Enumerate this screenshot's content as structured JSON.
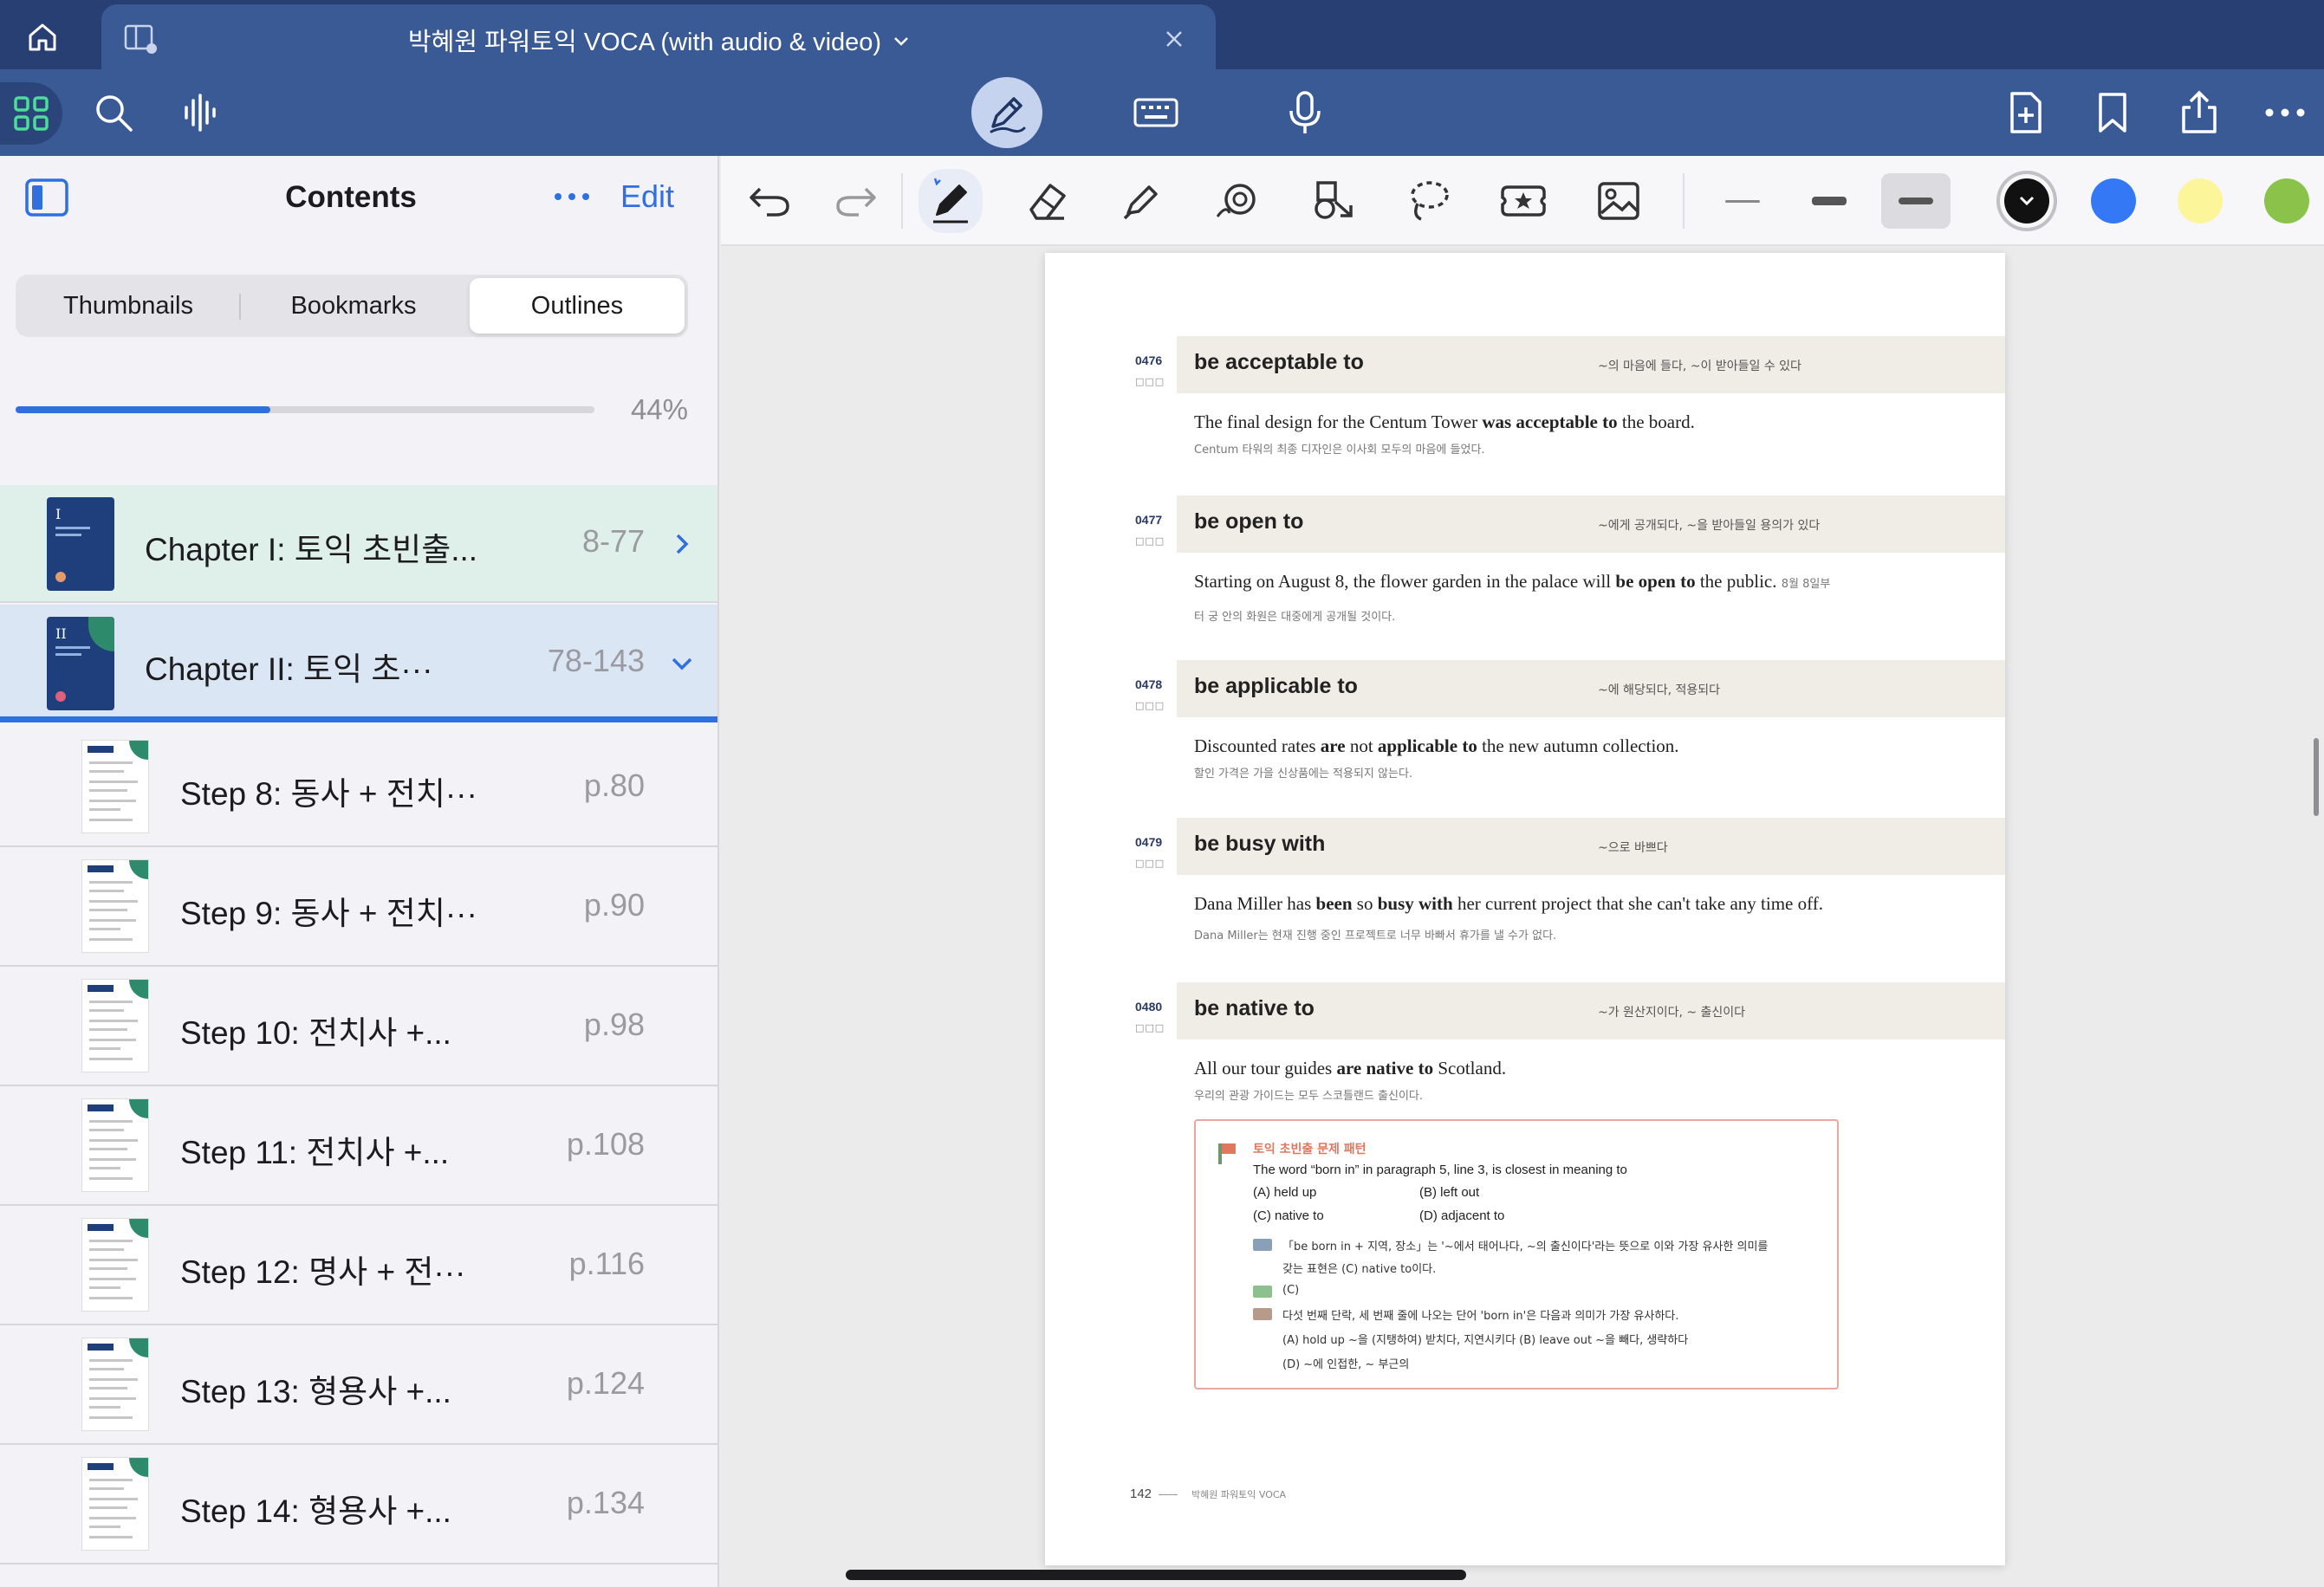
{
  "tab": {
    "title": "박혜원 파워토익 VOCA (with audio & video)"
  },
  "toolbar": {
    "icons": [
      "apps-grid-icon",
      "search-icon",
      "audio-waveform-icon",
      "pen-mode-icon",
      "keyboard-icon",
      "microphone-icon",
      "add-page-icon",
      "bookmark-icon",
      "share-icon",
      "more-icon"
    ]
  },
  "sidebar": {
    "title": "Contents",
    "edit_label": "Edit",
    "segments": [
      "Thumbnails",
      "Bookmarks",
      "Outlines"
    ],
    "selected_segment": "Outlines",
    "progress": {
      "percent": 44,
      "label": "44%"
    },
    "chapters": [
      {
        "label": "Chapter I: 토익 초빈출...",
        "pages": "8-77",
        "expanded": false,
        "numeral": "I"
      },
      {
        "label": "Chapter II: 토익 초···",
        "pages": "78-143",
        "expanded": true,
        "numeral": "II"
      }
    ],
    "steps": [
      {
        "label": "Step 8: 동사 + 전치···",
        "page": "p.80",
        "num": "8"
      },
      {
        "label": "Step 9: 동사 + 전치···",
        "page": "p.90",
        "num": "9"
      },
      {
        "label": "Step 10: 전치사 +...",
        "page": "p.98",
        "num": "10"
      },
      {
        "label": "Step 11: 전치사 +...",
        "page": "p.108",
        "num": "11"
      },
      {
        "label": "Step 12: 명사 + 전···",
        "page": "p.116",
        "num": "12"
      },
      {
        "label": "Step 13: 형용사 +...",
        "page": "p.124",
        "num": "13"
      },
      {
        "label": "Step 14: 형용사 +...",
        "page": "p.134",
        "num": "14"
      }
    ]
  },
  "annotation_bar": {
    "tools": [
      "undo-icon",
      "redo-icon",
      "pen-icon",
      "eraser-icon",
      "highlighter-icon",
      "shape-icon",
      "elements-icon",
      "lasso-icon",
      "sticker-icon",
      "image-icon"
    ],
    "active_tool": "pen-icon",
    "colors": [
      "#111111",
      "#3478f6",
      "#fdf59a",
      "#8bc34a"
    ],
    "selected_color": "#111111"
  },
  "document": {
    "entries": [
      {
        "num": "0476",
        "term": "be acceptable to",
        "meaning": "~의 마음에 들다, ~이 받아들일 수 있다",
        "example_parts": [
          "The final design for the Centum Tower ",
          "was acceptable to",
          " the board."
        ],
        "translation": "Centum 타워의 최종 디자인은 이사회 모두의 마음에 들었다."
      },
      {
        "num": "0477",
        "term": "be open to",
        "meaning": "~에게 공개되다, ~을 받아들일 용의가 있다",
        "example_parts": [
          "Starting on August 8, the flower garden in the palace will ",
          "be open to",
          " the public."
        ],
        "translation": "8월 8일부터 궁 안의 화원은 대중에게 공개될 것이다."
      },
      {
        "num": "0478",
        "term": "be applicable to",
        "meaning": "~에 해당되다, 적용되다",
        "example_parts": [
          "Discounted rates ",
          "are",
          " not ",
          "applicable to",
          " the new autumn collection."
        ],
        "translation": "할인 가격은 가을 신상품에는 적용되지 않는다."
      },
      {
        "num": "0479",
        "term": "be busy with",
        "meaning": "~으로 바쁘다",
        "example_parts": [
          "Dana Miller has ",
          "been",
          " so ",
          "busy with",
          " her current project that she can't take any time off."
        ],
        "translation": "Dana Miller는 현재 진행 중인 프로젝트로 너무 바빠서 휴가를 낼 수가 없다."
      },
      {
        "num": "0480",
        "term": "be native to",
        "meaning": "~가 원산지이다, ~ 출신이다",
        "example_parts": [
          "All our tour guides ",
          "are native to",
          " Scotland."
        ],
        "translation": "우리의 관광 가이드는 모두 스코틀랜드 출신이다."
      }
    ],
    "checkboxes": "□□□",
    "tip": {
      "title": "토익 초빈출 문제 패턴",
      "question": "The word “born in” in paragraph 5, line 3, is closest in meaning to",
      "options": [
        "(A) held up",
        "(B) left out",
        "(C) native to",
        "(D) adjacent to"
      ],
      "explanation_1": "「be born in + 지역, 장소」는 '~에서 태어나다, ~의 출신이다'라는 뜻으로 이와 가장 유사한 의미를",
      "explanation_2": "갖는 표현은 (C) native to이다.",
      "answer": "(C)",
      "note_1": "다섯 번째 단락, 세 번째 줄에 나오는 단어 'born in'은 다음과 의미가 가장 유사하다.",
      "note_2": "(A) hold up ~을 (지탱하여) 받치다, 지연시키다  (B) leave out ~을 빼다, 생략하다",
      "note_3": "(D) ~에 인접한, ~ 부근의"
    },
    "page_number": "142",
    "footer_brand": "박혜원 파워토익 VOCA"
  }
}
